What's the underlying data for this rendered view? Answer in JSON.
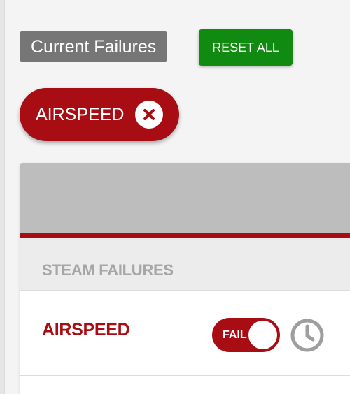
{
  "header": {
    "current_failures_label": "Current Failures",
    "reset_all_label": "RESET ALL"
  },
  "active_failures": [
    {
      "label": "AIRSPEED",
      "remove_icon": "close-icon"
    }
  ],
  "panel": {
    "section": {
      "title": "STEAM FAILURES",
      "items": [
        {
          "name": "AIRSPEED",
          "toggle_label": "FAIL",
          "toggle_state": "on",
          "schedule_icon": "clock-icon"
        }
      ]
    }
  },
  "colors": {
    "failure_red": "#a80d14",
    "reset_green": "#118a11",
    "label_gray": "#767676",
    "section_gray": "#a6a6a6",
    "header_gray": "#bdbdbd"
  }
}
